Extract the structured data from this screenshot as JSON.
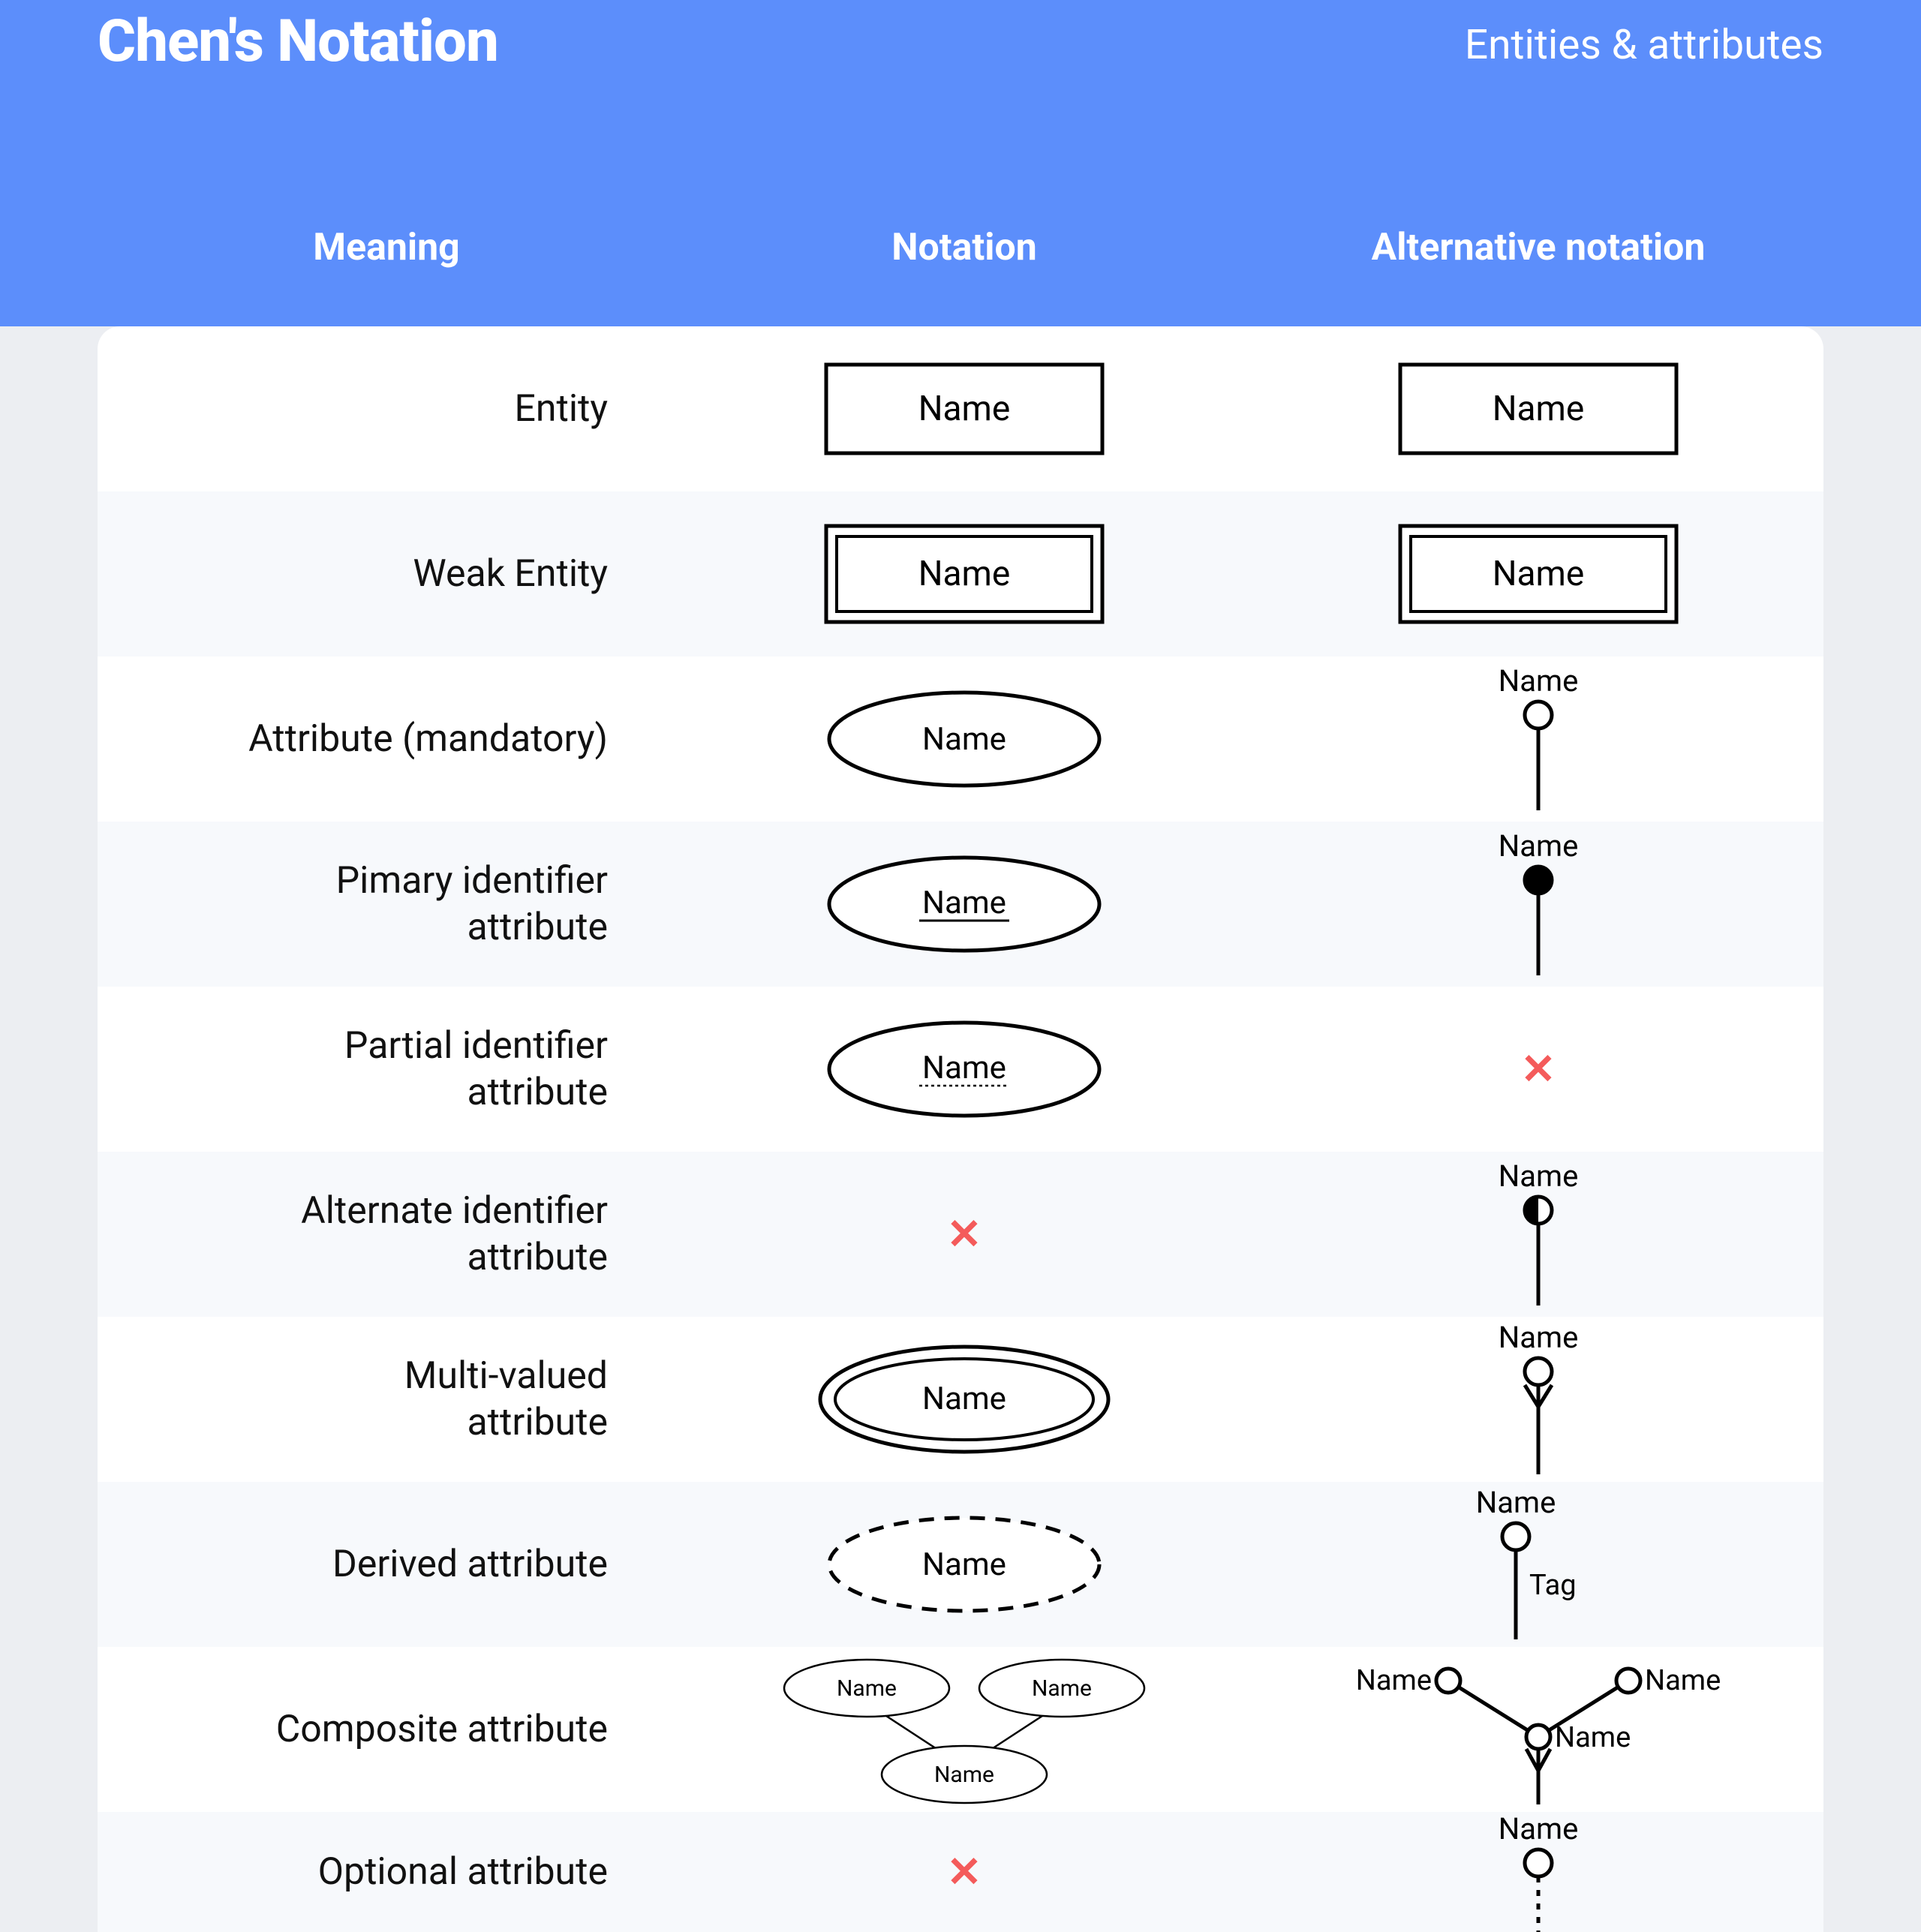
{
  "header": {
    "title": "Chen's Notation",
    "subtitle": "Entities & attributes",
    "col_meaning": "Meaning",
    "col_notation": "Notation",
    "col_alt": "Alternative notation"
  },
  "label_name": "Name",
  "label_tag": "Tag",
  "xmark": "✕",
  "rows": [
    {
      "meaning": "Entity"
    },
    {
      "meaning": "Weak Entity"
    },
    {
      "meaning": "Attribute (mandatory)"
    },
    {
      "meaning_l1": "Pimary identifier",
      "meaning_l2": "attribute"
    },
    {
      "meaning_l1": "Partial identifier",
      "meaning_l2": "attribute"
    },
    {
      "meaning_l1": "Alternate identifier",
      "meaning_l2": "attribute"
    },
    {
      "meaning_l1": "Multi-valued",
      "meaning_l2": "attribute"
    },
    {
      "meaning": "Derived attribute"
    },
    {
      "meaning": "Composite attribute"
    },
    {
      "meaning": "Optional attribute"
    }
  ],
  "chart_data": {
    "type": "table",
    "title": "Chen's Notation — Entities & attributes",
    "columns": [
      "Meaning",
      "Notation",
      "Alternative notation"
    ],
    "rows": [
      {
        "meaning": "Entity",
        "notation": "rectangle labeled Name",
        "alternative": "rectangle labeled Name"
      },
      {
        "meaning": "Weak Entity",
        "notation": "double-bordered rectangle labeled Name",
        "alternative": "double-bordered rectangle labeled Name"
      },
      {
        "meaning": "Attribute (mandatory)",
        "notation": "ellipse labeled Name",
        "alternative": "hollow-circle lollipop labeled Name"
      },
      {
        "meaning": "Primary identifier attribute",
        "notation": "ellipse, label Name underlined (solid)",
        "alternative": "filled-circle lollipop labeled Name"
      },
      {
        "meaning": "Partial identifier attribute",
        "notation": "ellipse, label Name underlined (dotted)",
        "alternative": "none (✕)"
      },
      {
        "meaning": "Alternate identifier attribute",
        "notation": "none (✕)",
        "alternative": "half-filled-circle lollipop labeled Name"
      },
      {
        "meaning": "Multi-valued attribute",
        "notation": "double-bordered ellipse labeled Name",
        "alternative": "hollow-circle lollipop with crow's-foot head, labeled Name"
      },
      {
        "meaning": "Derived attribute",
        "notation": "dashed ellipse labeled Name",
        "alternative": "hollow-circle lollipop labeled Name with Tag at side"
      },
      {
        "meaning": "Composite attribute",
        "notation": "ellipse Name with two child ellipses Name, Name",
        "alternative": "lollipop Name with two branching lollipops Name, Name and crow's-foot"
      },
      {
        "meaning": "Optional attribute",
        "notation": "none (✕)",
        "alternative": "hollow-circle lollipop labeled Name, dashed stem"
      }
    ]
  }
}
